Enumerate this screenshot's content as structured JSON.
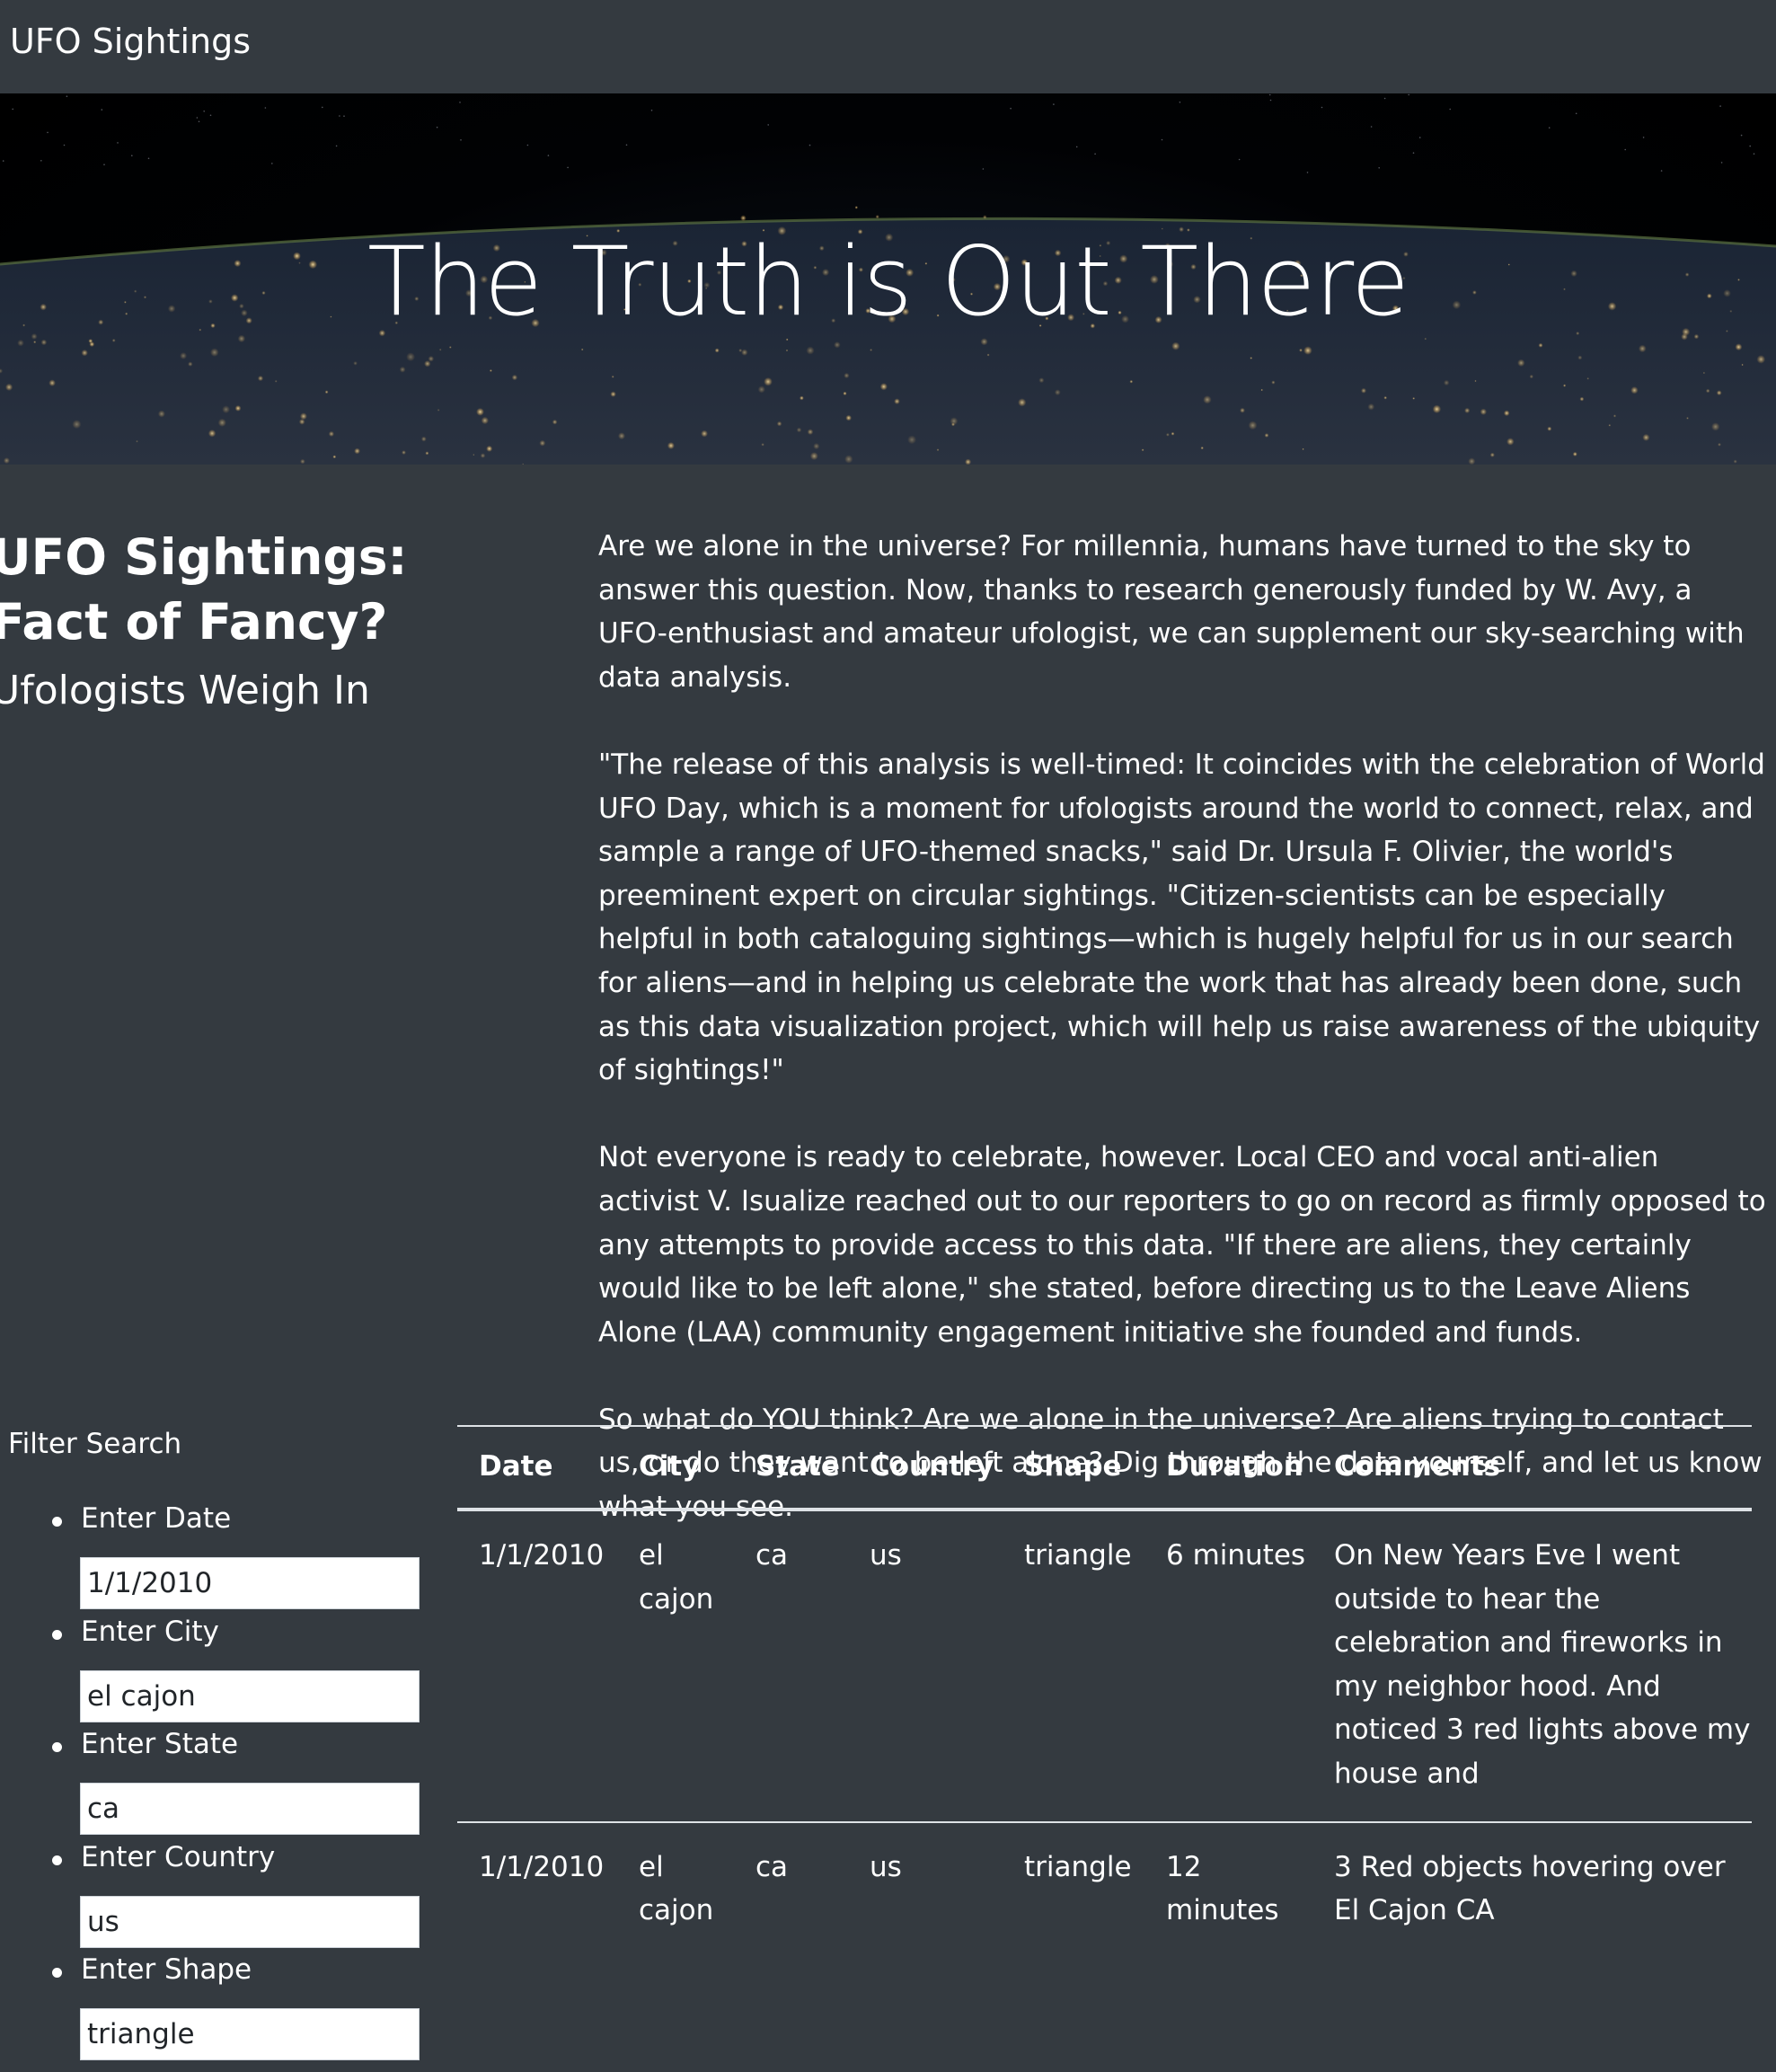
{
  "navbar": {
    "brand": "UFO Sightings"
  },
  "hero": {
    "title": "The Truth is Out There"
  },
  "headline": {
    "main": "UFO Sightings: Fact of Fancy?",
    "sub": "Ufologists Weigh In"
  },
  "article": {
    "paragraphs": [
      "Are we alone in the universe? For millennia, humans have turned to the sky to answer this question. Now, thanks to research generously funded by W. Avy, a UFO-enthusiast and amateur ufologist, we can supplement our sky-searching with data analysis.",
      "\"The release of this analysis is well-timed: It coincides with the celebration of World UFO Day, which is a moment for ufologists around the world to connect, relax, and sample a range of UFO-themed snacks,\" said Dr. Ursula F. Olivier, the world's preeminent expert on circular sightings. \"Citizen-scientists can be especially helpful in both cataloguing sightings—which is hugely helpful for us in our search for aliens—and in helping us celebrate the work that has already been done, such as this data visualization project, which will help us raise awareness of the ubiquity of sightings!\"",
      "Not everyone is ready to celebrate, however. Local CEO and vocal anti-alien activist V. Isualize reached out to our reporters to go on record as firmly opposed to any attempts to provide access to this data. \"If there are aliens, they certainly would like to be left alone,\" she stated, before directing us to the Leave Aliens Alone (LAA) community engagement initiative she founded and funds.",
      "So what do YOU think? Are we alone in the universe? Are aliens trying to contact us, or do they want to be left alone? Dig through the data yourself, and let us know what you see."
    ]
  },
  "filters": {
    "title": "Filter Search",
    "items": [
      {
        "label": "Enter Date",
        "value": "1/1/2010"
      },
      {
        "label": "Enter City",
        "value": "el cajon"
      },
      {
        "label": "Enter State",
        "value": "ca"
      },
      {
        "label": "Enter Country",
        "value": "us"
      },
      {
        "label": "Enter Shape",
        "value": "triangle"
      }
    ]
  },
  "table": {
    "headers": [
      "Date",
      "City",
      "State",
      "Country",
      "Shape",
      "Duration",
      "Comments"
    ],
    "rows": [
      [
        "1/1/2010",
        "el cajon",
        "ca",
        "us",
        "triangle",
        "6 minutes",
        "On New Years Eve I went outside to hear the celebration and fireworks in my neighbor hood. And noticed 3 red lights above my house and"
      ],
      [
        "1/1/2010",
        "el cajon",
        "ca",
        "us",
        "triangle",
        "12 minutes",
        "3 Red objects hovering over El Cajon CA"
      ]
    ]
  },
  "colors": {
    "background": "#343a40",
    "text": "#ffffff",
    "rule": "#dee2e6"
  }
}
